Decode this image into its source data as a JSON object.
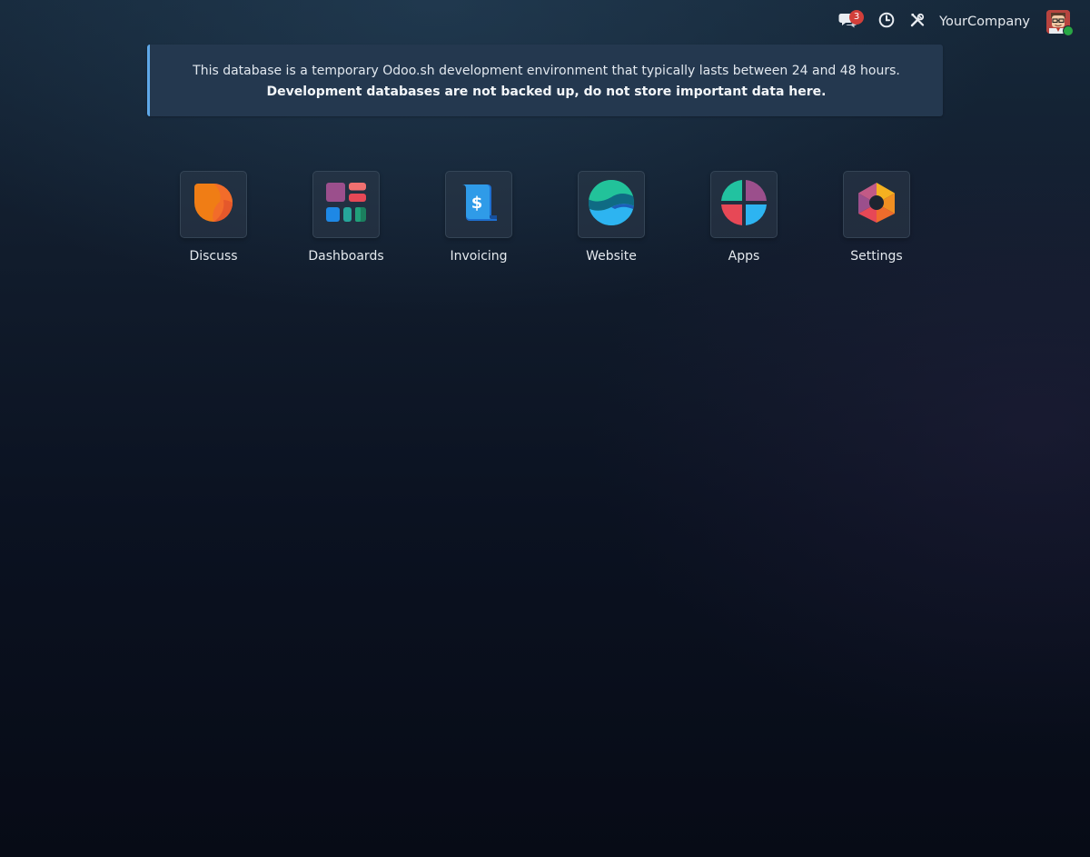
{
  "topbar": {
    "chat_badge_count": "3",
    "company_name": "YourCompany",
    "icons": {
      "chat": "chat-bubbles-icon",
      "activity": "clock-icon",
      "debug": "tools-icon",
      "avatar": "user-avatar"
    }
  },
  "alert": {
    "line1": "This database is a temporary Odoo.sh development environment that typically lasts between 24 and 48 hours.",
    "line2": "Development databases are not backed up, do not store important data here.",
    "accent_color": "#5fa8e8"
  },
  "apps": [
    {
      "label": "Discuss",
      "icon": "discuss-icon"
    },
    {
      "label": "Dashboards",
      "icon": "dashboards-icon"
    },
    {
      "label": "Invoicing",
      "icon": "invoicing-icon"
    },
    {
      "label": "Website",
      "icon": "website-icon"
    },
    {
      "label": "Apps",
      "icon": "apps-icon"
    },
    {
      "label": "Settings",
      "icon": "settings-icon"
    }
  ]
}
